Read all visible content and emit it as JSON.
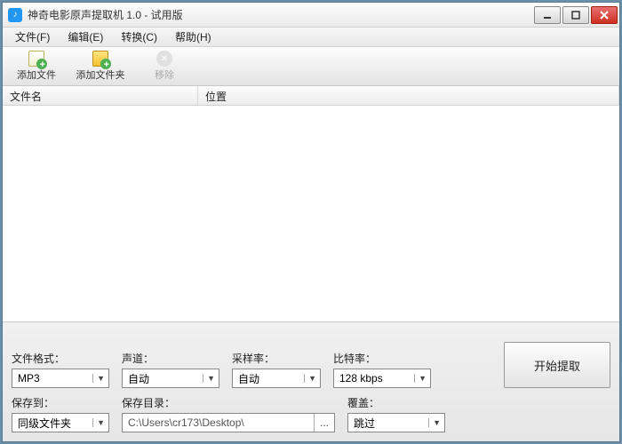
{
  "titlebar": {
    "app_icon_letter": "♪",
    "title": "神奇电影原声提取机 1.0 - 试用版"
  },
  "menubar": {
    "file": "文件(F)",
    "edit": "编辑(E)",
    "convert": "转换(C)",
    "help": "帮助(H)"
  },
  "toolbar": {
    "add_file": "添加文件",
    "add_folder": "添加文件夹",
    "remove": "移除"
  },
  "list": {
    "col_filename": "文件名",
    "col_location": "位置"
  },
  "bottom": {
    "format_label": "文件格式：",
    "format_value": "MP3",
    "channel_label": "声道：",
    "channel_value": "自动",
    "samplerate_label": "采样率：",
    "samplerate_value": "自动",
    "bitrate_label": "比特率：",
    "bitrate_value": "128 kbps",
    "saveto_label": "保存到：",
    "saveto_value": "同级文件夹",
    "savedir_label": "保存目录：",
    "savedir_value": "C:\\Users\\cr173\\Desktop\\",
    "browse_dots": "...",
    "overwrite_label": "覆盖：",
    "overwrite_value": "跳过",
    "start_button": "开始提取"
  }
}
